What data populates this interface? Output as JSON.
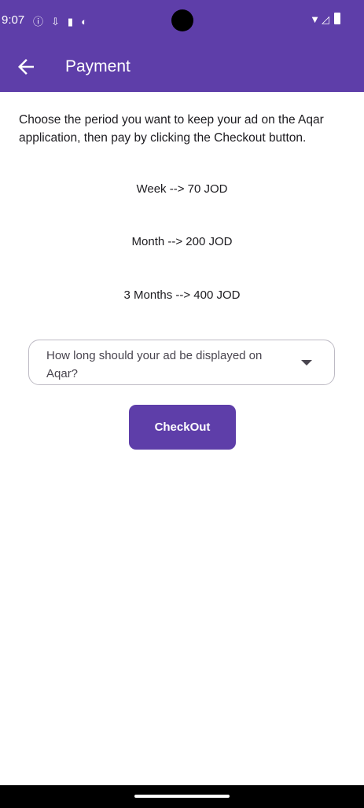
{
  "status_bar": {
    "time": "9:07",
    "icons": [
      "info-icon",
      "usb-icon",
      "sd-card-icon",
      "sync-icon"
    ],
    "system_icons": [
      "wifi-icon",
      "signal-icon",
      "battery-icon"
    ]
  },
  "app_bar": {
    "title": "Payment",
    "back_icon": "arrow-left-icon",
    "color": "#5e3ea9"
  },
  "intro_text": "Choose the period you want to keep your ad on the Aqar application, then pay by clicking the Checkout button.",
  "prices": [
    "Week --> 70 JOD",
    "Month --> 200 JOD",
    "3 Months --> 400 JOD"
  ],
  "dropdown": {
    "hint": "How long should your ad be displayed on Aqar?",
    "icon": "caret-down-icon"
  },
  "checkout_button": {
    "label": "CheckOut",
    "color": "#5e3ea9"
  }
}
